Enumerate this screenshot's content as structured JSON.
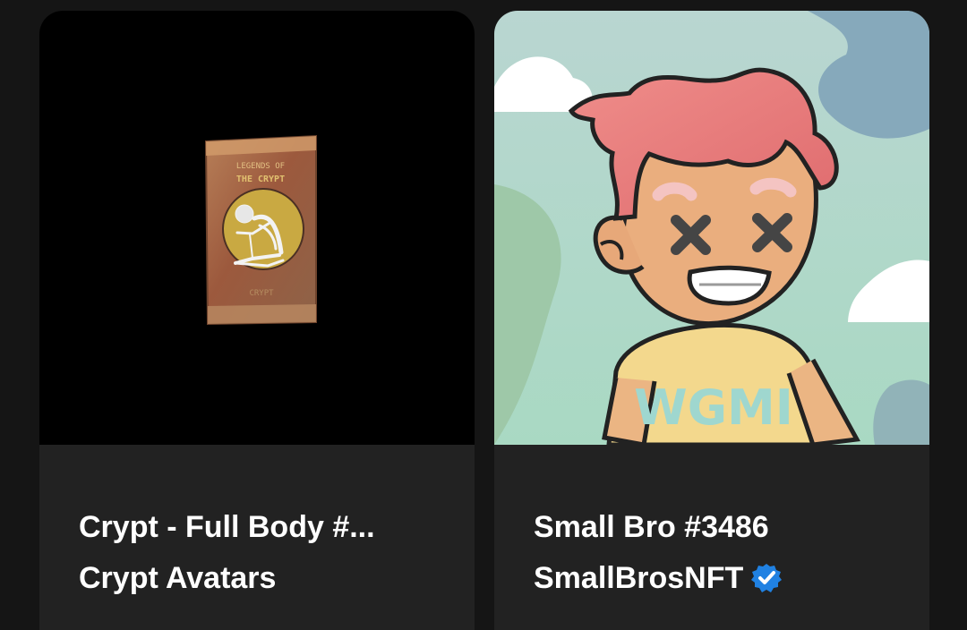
{
  "cards": [
    {
      "title": "Crypt - Full Body #...",
      "collection": "Crypt Avatars",
      "image_icon": "trading-card-pack-skeleton",
      "pack_text": {
        "top": "LEGENDS OF",
        "second": "THE CRYPT",
        "bottom": "CRYPT"
      }
    },
    {
      "title": "Small Bro #3486",
      "collection": "SmallBrosNFT",
      "verified": true,
      "image_icon": "pink-hair-boy-avatar",
      "shirt_text": "WGMI"
    }
  ],
  "colors": {
    "background": "#151515",
    "card": "#222222",
    "text": "#ffffff",
    "verified": "#2081e2"
  }
}
